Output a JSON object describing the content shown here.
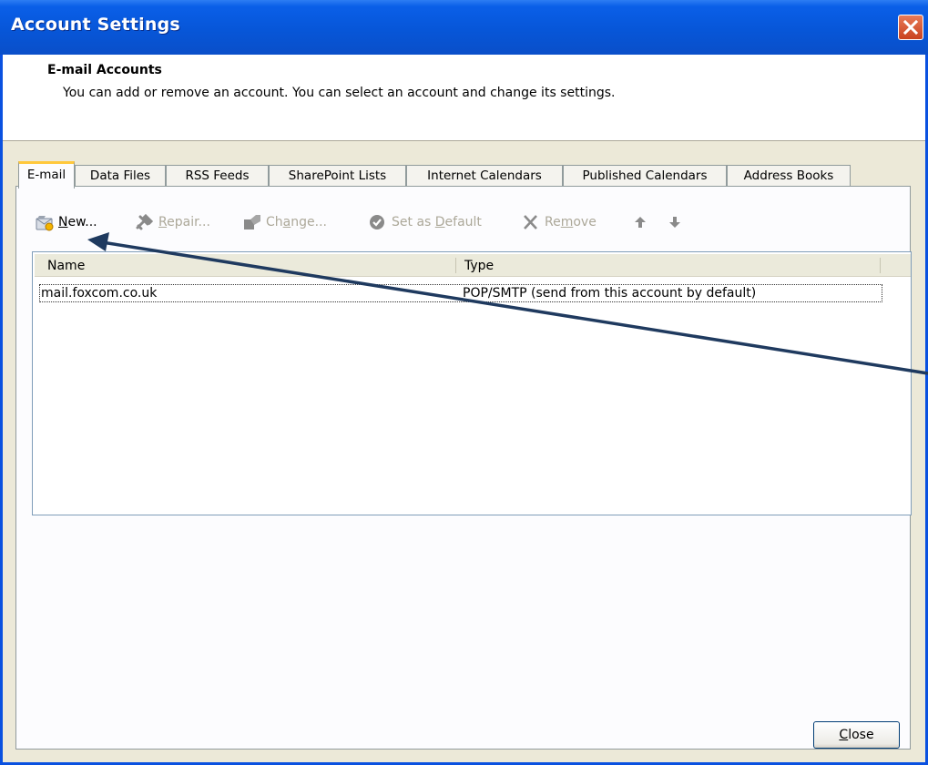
{
  "window": {
    "title": "Account Settings"
  },
  "header": {
    "title": "E-mail Accounts",
    "description": "You can add or remove an account. You can select an account and change its settings."
  },
  "tabs": [
    {
      "label": "E-mail",
      "active": true
    },
    {
      "label": "Data Files"
    },
    {
      "label": "RSS Feeds"
    },
    {
      "label": "SharePoint Lists"
    },
    {
      "label": "Internet Calendars"
    },
    {
      "label": "Published Calendars"
    },
    {
      "label": "Address Books"
    }
  ],
  "toolbar": {
    "new": {
      "pre": "",
      "key": "N",
      "post": "ew..."
    },
    "repair": {
      "pre": "",
      "key": "R",
      "post": "epair..."
    },
    "change": {
      "pre": "Ch",
      "key": "a",
      "post": "nge..."
    },
    "set_default": {
      "pre": "Set as ",
      "key": "D",
      "post": "efault"
    },
    "remove": {
      "pre": "Re",
      "key": "m",
      "post": "ove"
    }
  },
  "list": {
    "columns": [
      "Name",
      "Type"
    ],
    "rows": [
      {
        "name": "mail.foxcom.co.uk",
        "type": "POP/SMTP (send from this account by default)"
      }
    ]
  },
  "buttons": {
    "close": {
      "key": "C",
      "post": "lose"
    }
  },
  "colors": {
    "titlebar": "#0a5fe8",
    "annotation_arrow": "#1f3a5f",
    "dialog_bg": "#ece9d8"
  }
}
